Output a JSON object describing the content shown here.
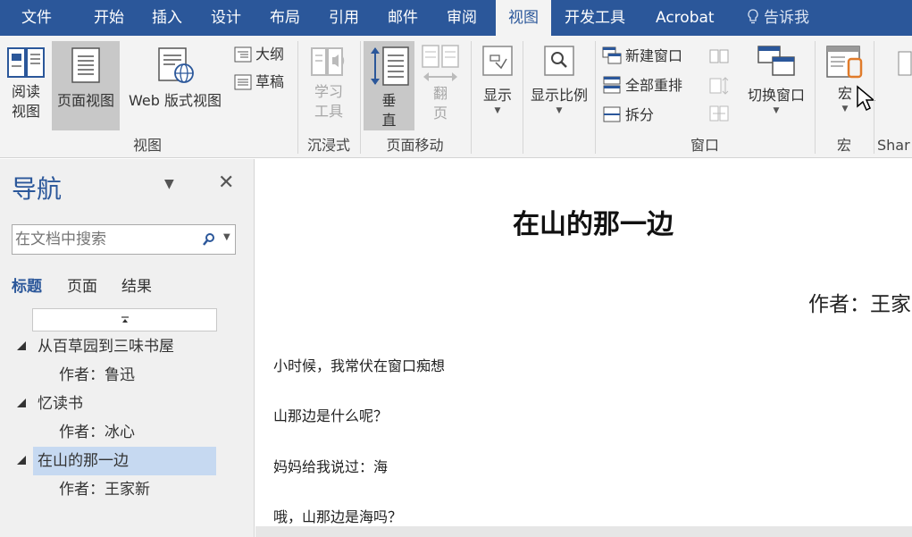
{
  "tabs": [
    "文件",
    "开始",
    "插入",
    "设计",
    "布局",
    "引用",
    "邮件",
    "审阅",
    "视图",
    "开发工具",
    "Acrobat"
  ],
  "tell_me": "告诉我",
  "ribbon": {
    "reading_view": [
      "阅读",
      "视图"
    ],
    "print_layout": "页面视图",
    "web_layout": "Web 版式视图",
    "outline": "大纲",
    "draft": "草稿",
    "learning_tools": [
      "学习",
      "工具"
    ],
    "vertical": [
      "垂",
      "直"
    ],
    "side_to_side": [
      "翻",
      "页"
    ],
    "show": "显示",
    "zoom": "显示比例",
    "new_window": "新建窗口",
    "arrange_all": "全部重排",
    "split": "拆分",
    "switch_windows": "切换窗口",
    "macros": "宏",
    "share_partial": "Shar",
    "groups": {
      "views": "视图",
      "immersive": "沉浸式",
      "page_movement": "页面移动",
      "window": "窗口",
      "macros": "宏"
    }
  },
  "nav": {
    "title": "导航",
    "search_placeholder": "在文档中搜索",
    "tabs": [
      "标题",
      "页面",
      "结果"
    ],
    "headings": [
      {
        "title": "从百草园到三味书屋",
        "author": "作者：鲁迅"
      },
      {
        "title": "忆读书",
        "author": "作者：冰心"
      },
      {
        "title": "在山的那一边",
        "author": "作者：王家新"
      }
    ]
  },
  "doc": {
    "title": "在山的那一边",
    "author": "作者：王家",
    "paragraphs": [
      "小时候，我常伏在窗口痴想",
      "山那边是什么呢？",
      "妈妈给我说过：海",
      "哦，山那边是海吗？"
    ]
  },
  "colors": {
    "accent": "#2b579a",
    "selection": "#c6d9f1",
    "ribbon_bg": "#f3f3f3"
  }
}
